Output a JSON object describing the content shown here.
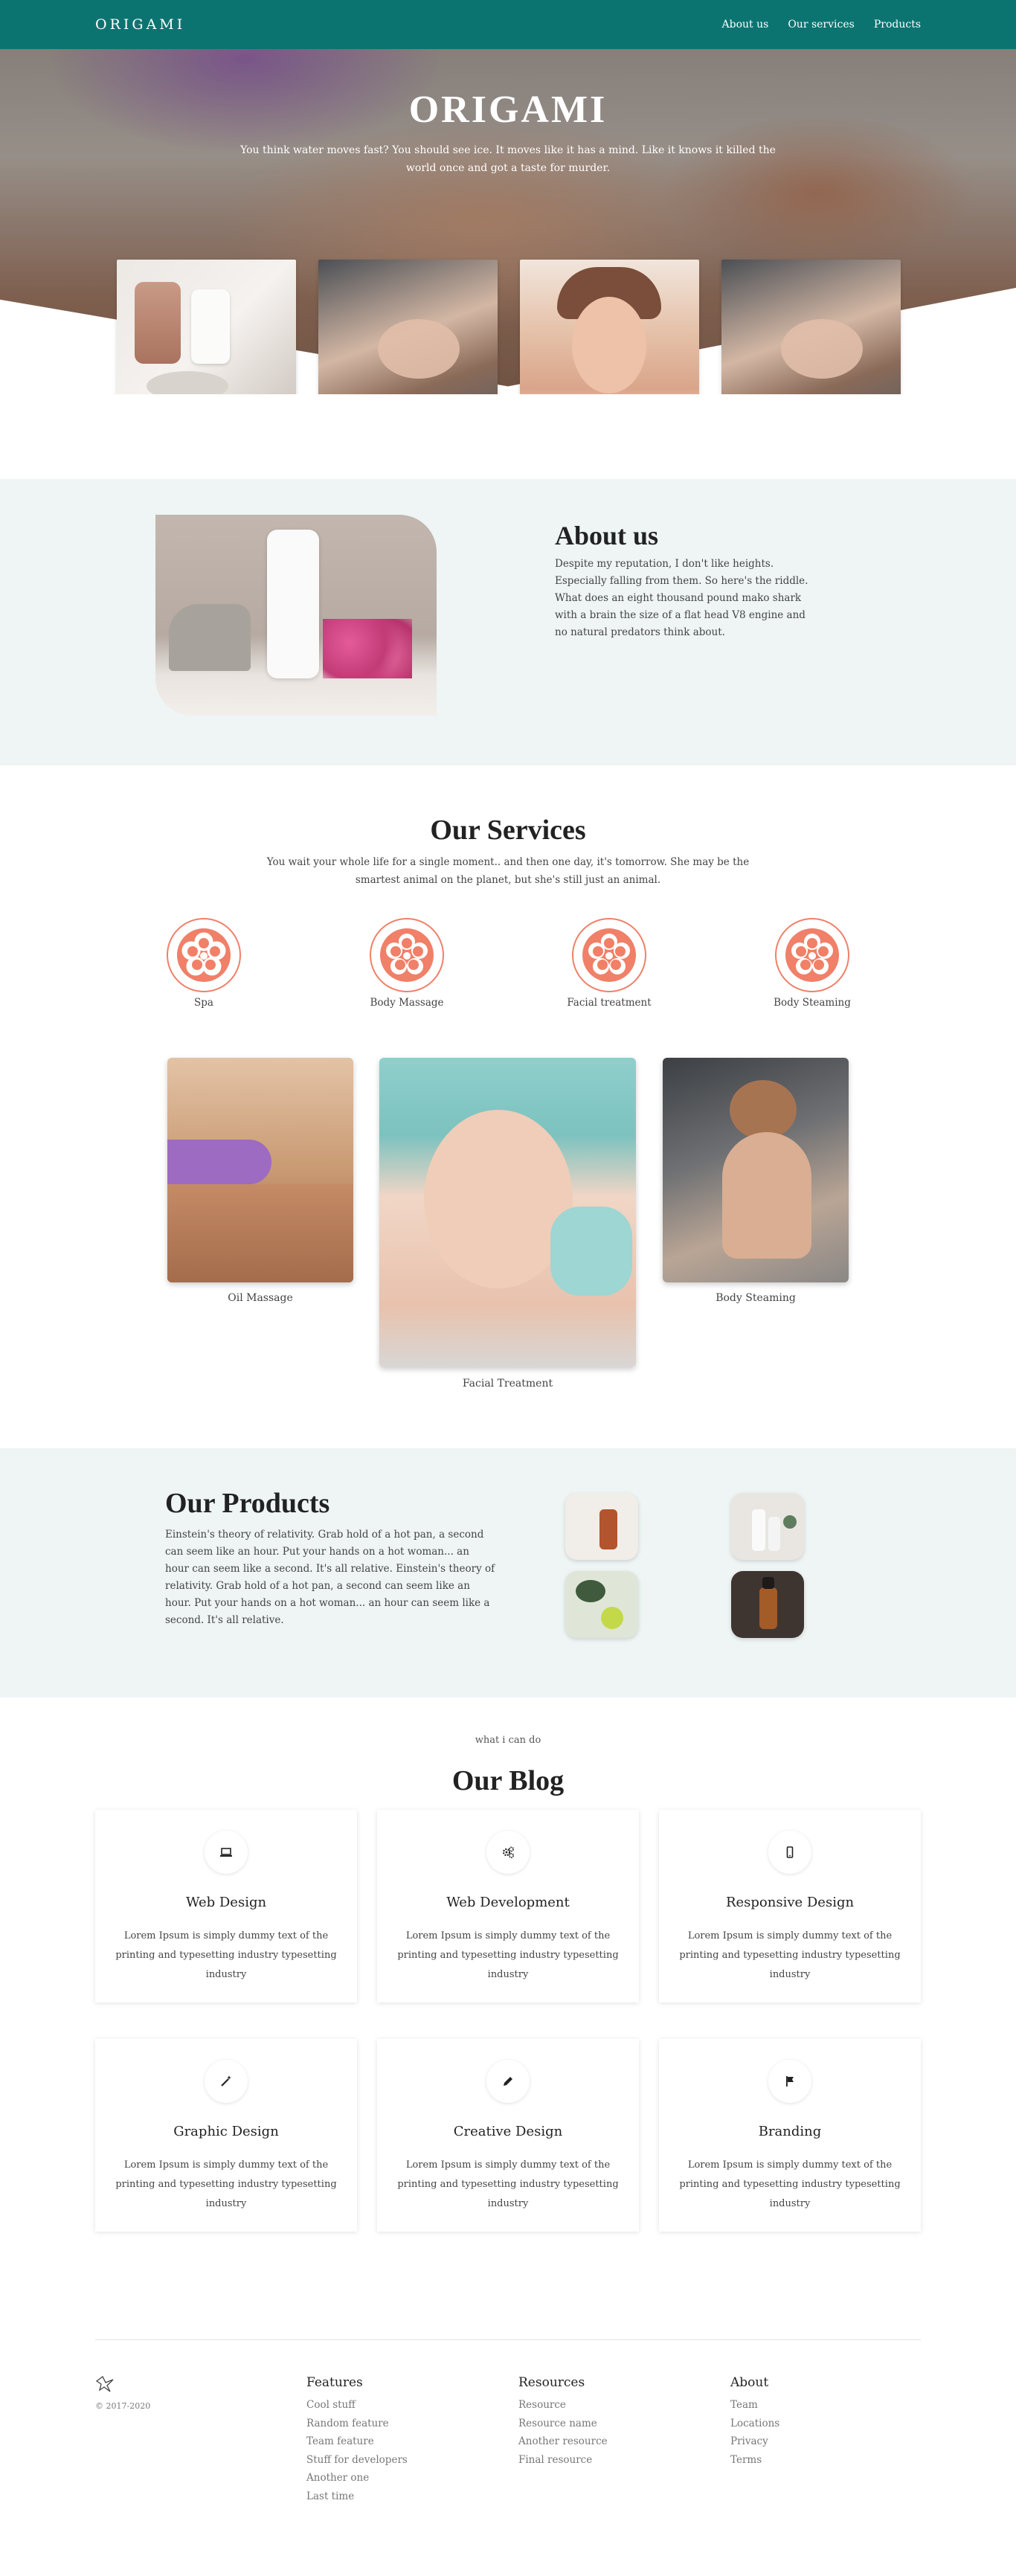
{
  "nav": {
    "brand": "ORIGAMI",
    "links": [
      "About us",
      "Our services",
      "Products"
    ]
  },
  "hero": {
    "title": "ORIGAMI",
    "subtitle": "You think water moves fast? You should see ice. It moves like it has a mind. Like it knows it killed the world once and got a taste for murder."
  },
  "about": {
    "title": "About us",
    "text": "Despite my reputation, I don't like heights. Especially falling from them. So here's the riddle. What does an eight thousand pound mako shark with a brain the size of a flat head V8 engine and no natural predators think about."
  },
  "services": {
    "title": "Our Services",
    "subtitle": "You wait your whole life for a single moment.. and then one day, it's tomorrow. She may be the smartest animal on the planet, but she's still just an animal.",
    "icons": [
      {
        "label": "Spa"
      },
      {
        "label": "Body Massage"
      },
      {
        "label": "Facial treatment"
      },
      {
        "label": "Body Steaming"
      }
    ],
    "photos": [
      {
        "caption": "Oil Massage"
      },
      {
        "caption": "Facial Treatment"
      },
      {
        "caption": "Body Steaming"
      }
    ],
    "accent": "#f08068"
  },
  "products": {
    "title": "Our Products",
    "text": "Einstein's theory of relativity. Grab hold of a hot pan, a second can seem like an hour. Put your hands on a hot woman... an hour can seem like a second. It's all relative. Einstein's theory of relativity. Grab hold of a hot pan, a second can seem like an hour. Put your hands on a hot woman... an hour can seem like a second. It's all relative."
  },
  "blog": {
    "kicker": "what i can do",
    "title": "Our Blog",
    "cards": [
      {
        "title": "Web Design",
        "icon": "laptop-icon",
        "text": "Lorem Ipsum is simply dummy text of the printing and typesetting industry typesetting industry"
      },
      {
        "title": "Web Development",
        "icon": "gears-icon",
        "text": "Lorem Ipsum is simply dummy text of the printing and typesetting industry typesetting industry"
      },
      {
        "title": "Responsive Design",
        "icon": "mobile-icon",
        "text": "Lorem Ipsum is simply dummy text of the printing and typesetting industry typesetting industry"
      },
      {
        "title": "Graphic Design",
        "icon": "magic-wand-icon",
        "text": "Lorem Ipsum is simply dummy text of the printing and typesetting industry typesetting industry"
      },
      {
        "title": "Creative Design",
        "icon": "pencil-icon",
        "text": "Lorem Ipsum is simply dummy text of the printing and typesetting industry typesetting industry"
      },
      {
        "title": "Branding",
        "icon": "flag-icon",
        "text": "Lorem Ipsum is simply dummy text of the printing and typesetting industry typesetting industry"
      }
    ]
  },
  "footer": {
    "copyright": "© 2017-2020",
    "columns": [
      {
        "title": "Features",
        "links": [
          "Cool stuff",
          "Random feature",
          "Team feature",
          "Stuff for developers",
          "Another one",
          "Last time"
        ]
      },
      {
        "title": "Resources",
        "links": [
          "Resource",
          "Resource name",
          "Another resource",
          "Final resource"
        ]
      },
      {
        "title": "About",
        "links": [
          "Team",
          "Locations",
          "Privacy",
          "Terms"
        ]
      }
    ]
  },
  "colors": {
    "nav": "#0b7470",
    "section_bg": "#eef5f4",
    "accent": "#f08068"
  }
}
